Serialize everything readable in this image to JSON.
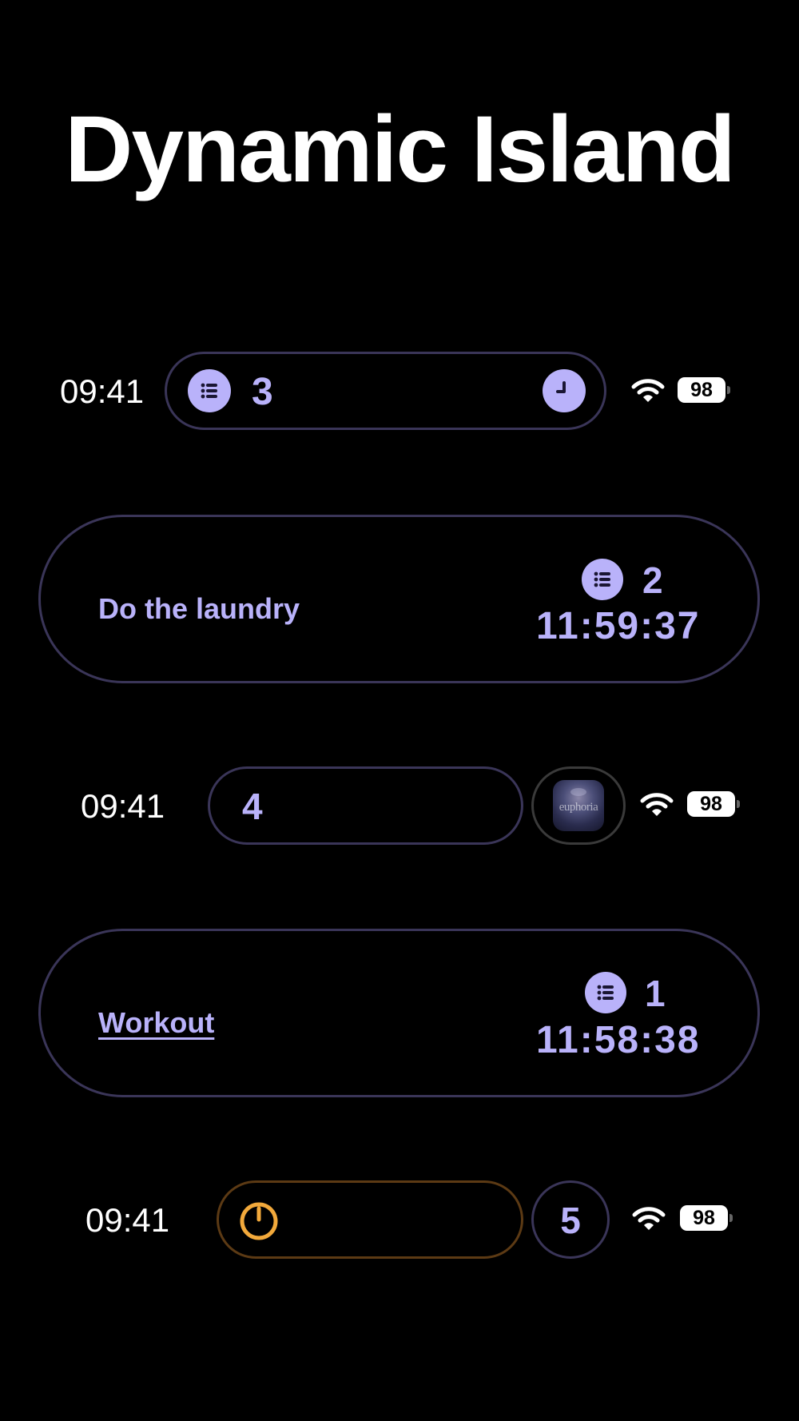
{
  "title": "Dynamic Island",
  "rows": {
    "row1": {
      "time": "09:41",
      "count": "3",
      "battery": "98"
    },
    "row2": {
      "task": "Do the laundry",
      "count": "2",
      "timer": "11:59:37"
    },
    "row3": {
      "time": "09:41",
      "count": "4",
      "album_text": "euphoria",
      "battery": "98"
    },
    "row4": {
      "task": "Workout",
      "count": "1",
      "timer": "11:58:38"
    },
    "row5": {
      "time": "09:41",
      "count": "5",
      "battery": "98"
    }
  },
  "colors": {
    "background": "#000000",
    "accent": "#b9b2fa",
    "pill_border": "#3a3558",
    "orange": "#f2a93b",
    "orange_border": "#5c3a14"
  },
  "icons": {
    "list": "list-icon",
    "clock": "clock-icon",
    "wifi": "wifi-icon",
    "battery": "battery-icon",
    "timer": "timer-icon"
  }
}
